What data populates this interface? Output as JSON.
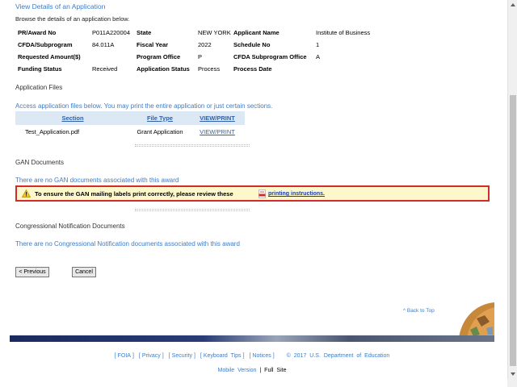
{
  "header": {
    "title": "View Details of an Application",
    "browse_note": "Browse the details of an application below."
  },
  "details": {
    "pr_award_label": "PR/Award No",
    "pr_award_value": "P011A220004",
    "state_label": "State",
    "state_value": "NEW YORK",
    "applicant_label": "Applicant Name",
    "applicant_value": "Institute of Business",
    "cfda_label": "CFDA/Subprogram",
    "cfda_value": "84.011A",
    "fiscal_year_label": "Fiscal Year",
    "fiscal_year_value": "2022",
    "schedule_label": "Schedule No",
    "schedule_value": "1",
    "requested_label": "Requested Amount($)",
    "requested_value": "",
    "program_office_label": "Program Office",
    "program_office_value": "P",
    "cfda_sub_office_label": "CFDA Subprogram Office",
    "cfda_sub_office_value": "A",
    "funding_status_label": "Funding Status",
    "funding_status_value": "Received",
    "app_status_label": "Application Status",
    "app_status_value": "Process",
    "process_date_label": "Process Date",
    "process_date_value": ""
  },
  "application_files": {
    "heading": "Application Files",
    "note": "Access application files below. You may print the entire application or just certain sections.",
    "columns": [
      "Section",
      "File Type",
      "VIEW/PRINT"
    ],
    "rows": [
      {
        "section": "Test_Application.pdf",
        "file_type": "Grant Application",
        "action": "VIEW/PRINT"
      }
    ]
  },
  "gan": {
    "heading": "GAN Documents",
    "none_text": "There are no GAN documents associated with this award",
    "warning_text": "To ensure the GAN mailing labels print correctly, please review these",
    "warning_link": "printing instructions."
  },
  "congressional": {
    "heading": "Congressional Notification Documents",
    "none_text": "There are no Congressional Notification documents associated with this award"
  },
  "buttons": {
    "previous": "< Previous",
    "cancel": "Cancel"
  },
  "back_to_top": "^ Back to Top",
  "footer": {
    "links": [
      "FOIA",
      "Privacy",
      "Security",
      "Keyboard Tips",
      "Notices"
    ],
    "copyright": "© 2017 U.S. Department of Education",
    "mobile_version": "Mobile Version",
    "separator": "|",
    "full_site": "Full Site"
  },
  "colors": {
    "link_blue": "#3d7cc9",
    "table_header_bg": "#dce9f5",
    "warning_bg": "#fdf8cc",
    "warning_border": "#d42b2b"
  },
  "icons": [
    "warning-icon",
    "pdf-icon",
    "earth-icon"
  ]
}
